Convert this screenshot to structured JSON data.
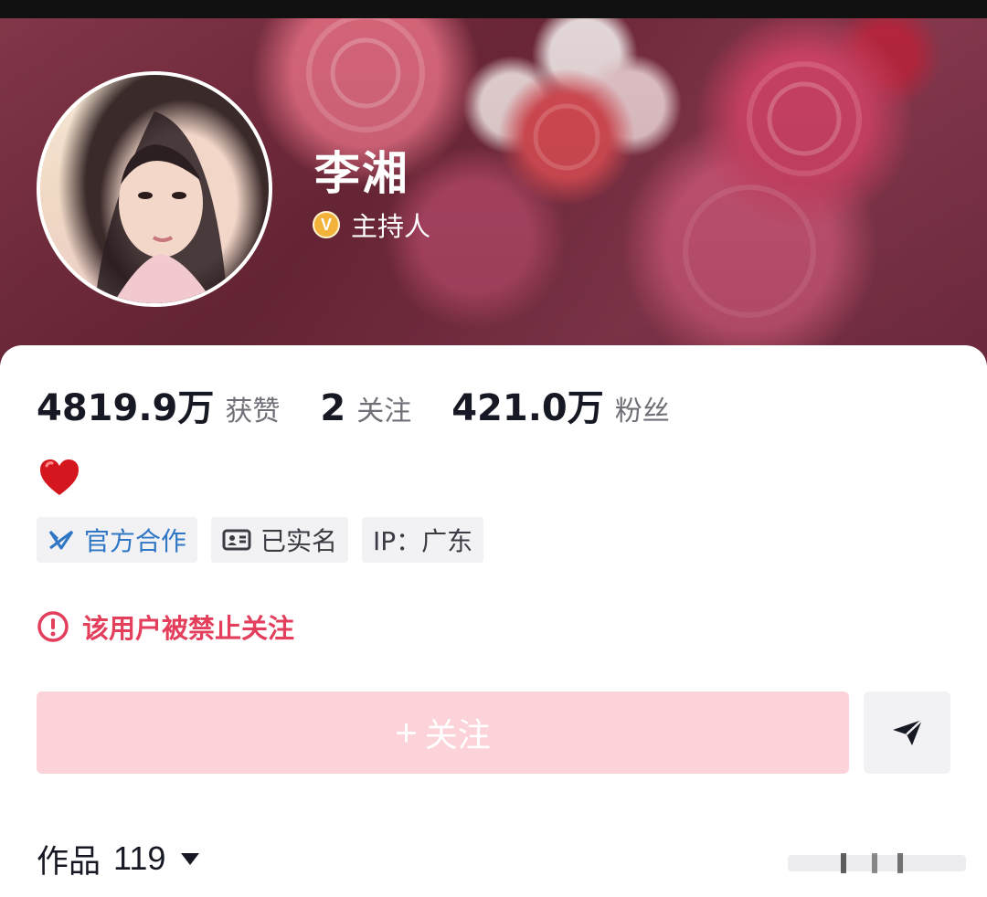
{
  "profile": {
    "name": "李湘",
    "role": "主持人",
    "verified_badge": "V",
    "avatar_icon": "avatar-photo"
  },
  "stats": {
    "likes_value": "4819.9万",
    "likes_label": "获赞",
    "following_value": "2",
    "following_label": "关注",
    "followers_value": "421.0万",
    "followers_label": "粉丝"
  },
  "bio": {
    "emoji": "heart-emoji"
  },
  "tags": [
    {
      "label": "官方合作",
      "icon": "official-cooperation-icon"
    },
    {
      "label": "已实名",
      "icon": "id-card-icon"
    },
    {
      "label": "IP：广东",
      "icon": ""
    }
  ],
  "warning": {
    "text": "该用户被禁止关注",
    "icon": "alert-circle-icon"
  },
  "actions": {
    "follow_plus": "+",
    "follow_label": "关注",
    "share_icon": "send-icon"
  },
  "works": {
    "label": "作品",
    "count": "119",
    "dropdown_icon": "caret-down-icon"
  },
  "colors": {
    "accent_red": "#e33e5c",
    "follow_button_bg": "#fbd3d9",
    "official_blue": "#2f77c4",
    "badge_gold": "#f3b33a"
  }
}
